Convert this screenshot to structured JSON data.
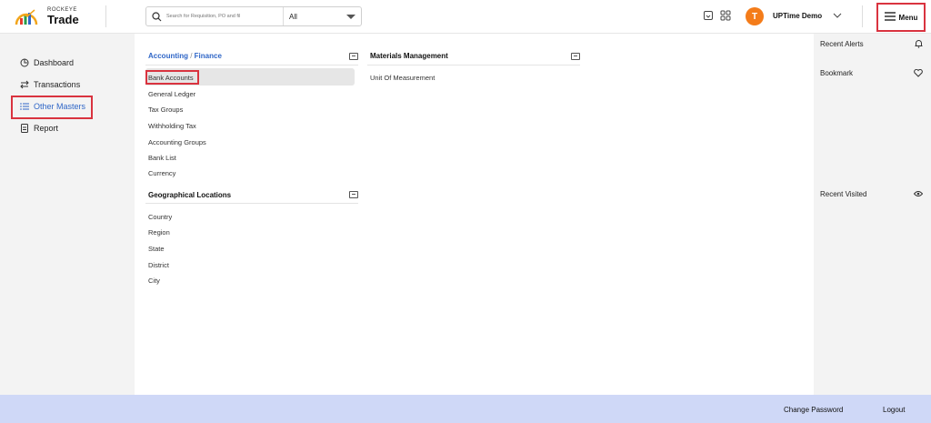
{
  "app": {
    "logo_small": "ROCKEYE",
    "logo_big": "Trade"
  },
  "search": {
    "placeholder": "Search for Requisition, PO and fil",
    "scope_value": "All"
  },
  "user": {
    "initial": "T",
    "name": "UPTime Demo"
  },
  "menu": {
    "label": "Menu"
  },
  "sidebar": {
    "items": [
      {
        "label": "Dashboard",
        "icon": "dashboard-icon"
      },
      {
        "label": "Transactions",
        "icon": "transfer-icon"
      },
      {
        "label": "Other Masters",
        "icon": "list-icon",
        "active": true
      },
      {
        "label": "Report",
        "icon": "document-icon"
      }
    ]
  },
  "sections": {
    "accounting": {
      "title_a": "Accounting",
      "title_sep": " / ",
      "title_b": "Finance",
      "items": [
        "Bank Accounts",
        "General Ledger",
        "Tax Groups",
        "Withholding Tax",
        "Accounting Groups",
        "Bank List",
        "Currency"
      ]
    },
    "geo": {
      "title": "Geographical Locations",
      "items": [
        "Country",
        "Region",
        "State",
        "District",
        "City"
      ]
    },
    "materials": {
      "title": "Materials Management",
      "items": [
        "Unit Of Measurement"
      ]
    }
  },
  "right_panel": {
    "recent_alerts": "Recent Alerts",
    "bookmark": "Bookmark",
    "recent_visited": "Recent Visited"
  },
  "footer": {
    "change_password": "Change Password",
    "logout": "Logout"
  },
  "colors": {
    "accent": "#2f66c7",
    "highlight_border": "#d9333f",
    "avatar": "#f47c1a",
    "footer": "#cfd8f7",
    "sidebar_bg": "#f3f3f3"
  }
}
